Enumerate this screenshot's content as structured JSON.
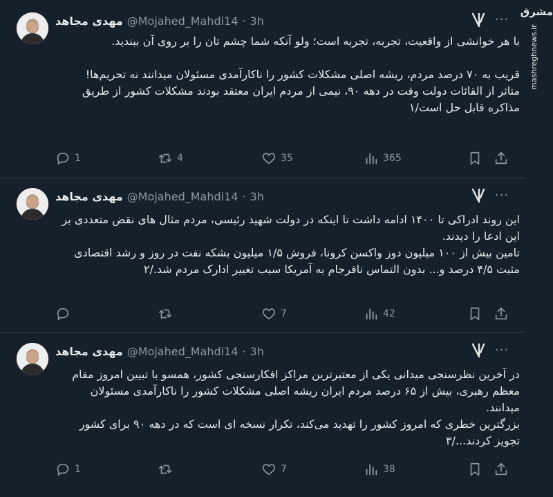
{
  "watermark": {
    "logo_text": "مشرق",
    "url": "mashreghnews.ir"
  },
  "tweets": [
    {
      "name": "مهدی مجاهد",
      "handle": "@Mojahed_Mahdi14",
      "sep": "·",
      "time": "3h",
      "more": "···",
      "text": "با هر خوانشی از واقعیت، تجربه، تجربه است؛ ولو آنکه شما چشم تان را بر روی آن ببندید.\n\nقریب به ۷۰ درصد مردم، ریشه اصلی مشکلات کشور را ناکارآمدی مسئولان میدانند نه تحریم‌ها!\nمتاثر از القائات دولت وقت در دهه ۹۰، نیمی از مردم ایران معتقد بودند مشکلات کشور از طریق مذاکره قابل حل است/۱",
      "replies": "1",
      "retweets": "4",
      "likes": "35",
      "views": "365"
    },
    {
      "name": "مهدی مجاهد",
      "handle": "@Mojahed_Mahdi14",
      "sep": "·",
      "time": "3h",
      "more": "···",
      "text": "این روند ادراکی تا ۱۴۰۰ ادامه داشت تا اینکه در دولت شهید رئیسی، مردم مثال های نقض متعددی بر این ادعا را دیدند.\nتامین بیش از ۱۰۰ میلیون دوز واکسن کرونا، فروش ۱/۵ میلیون بشکه نفت در روز و رشد اقتصادی مثبت ۴/۵ درصد و... بدون التماس نافرجام به آمریکا سبب تغییر ادارک مردم شد./۲",
      "replies": "",
      "retweets": "",
      "likes": "7",
      "views": "42"
    },
    {
      "name": "مهدی مجاهد",
      "handle": "@Mojahed_Mahdi14",
      "sep": "·",
      "time": "3h",
      "more": "···",
      "text": "در آخرین نظرسنجی میدانی یکی از معتبرترین مراکز افکارسنجی کشور، همسو با تبیین امروز مقام معظم رهبری، بیش از ۶۵ درصد مردم ایران ریشه اصلی مشکلات کشور را ناکارآمدی مسئولان میدانند.\nبزرگترین خطری که امروز کشور را تهدید می‌کند، تکرار نسخه ای است که در دهه ۹۰ برای کشور تجویز کردند.../۳",
      "replies": "1",
      "retweets": "",
      "likes": "7",
      "views": "38"
    }
  ],
  "colors": {
    "background": "#15202b",
    "text": "#e7e9ea",
    "muted": "#8b98a5",
    "divider": "#38444d"
  },
  "icons": [
    "verified-x-icon",
    "more-icon",
    "reply-icon",
    "retweet-icon",
    "like-icon",
    "views-icon",
    "bookmark-icon",
    "share-icon"
  ]
}
